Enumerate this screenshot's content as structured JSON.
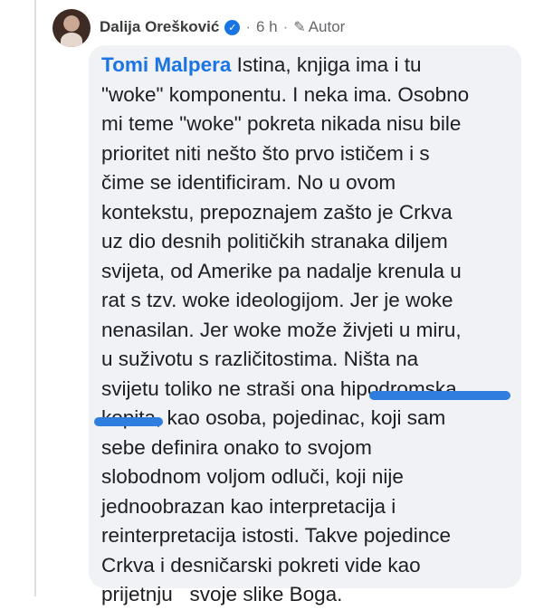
{
  "comment": {
    "author": "Dalija Orešković",
    "time": "6 h",
    "separator": "·",
    "badge_label": "Autor",
    "mention": "Tomi Malpera",
    "lines": [
      " Istina, knjiga ima i tu",
      "\"woke\" komponentu. I neka ima. Osobno",
      "mi teme \"woke\" pokreta nikada nisu bile",
      "prioritet niti nešto što prvo ističem i s",
      "čime se identificiram. No u ovom",
      "kontekstu, prepoznajem zašto je Crkva",
      "uz dio desnih političkih stranaka diljem",
      "svijeta, od Amerike pa nadalje krenula u",
      "rat s tzv. woke ideologijom. Jer je woke",
      "nenasilan. Jer woke može živjeti u miru,",
      "u suživotu s različitostima. Ništa na",
      "svijetu toliko ne straši ona hipodromska",
      "kopita, kao osoba, pojedinac, koji sam",
      "sebe definira onako to svojom",
      "slobodnom voljom odluči, koji nije",
      "jednoobrazan kao interpretacija i",
      "reinterpretacija istosti. Takve pojedince",
      "Crkva i desničarski pokreti vide kao",
      "prijetnju   svoje slike Boga."
    ]
  },
  "icons": {
    "verified": "verified-check-icon",
    "pencil": "pencil-icon"
  },
  "colors": {
    "mention": "#1b74e4",
    "bubble": "#f0f2f5",
    "highlight": "#2f7ddf"
  }
}
